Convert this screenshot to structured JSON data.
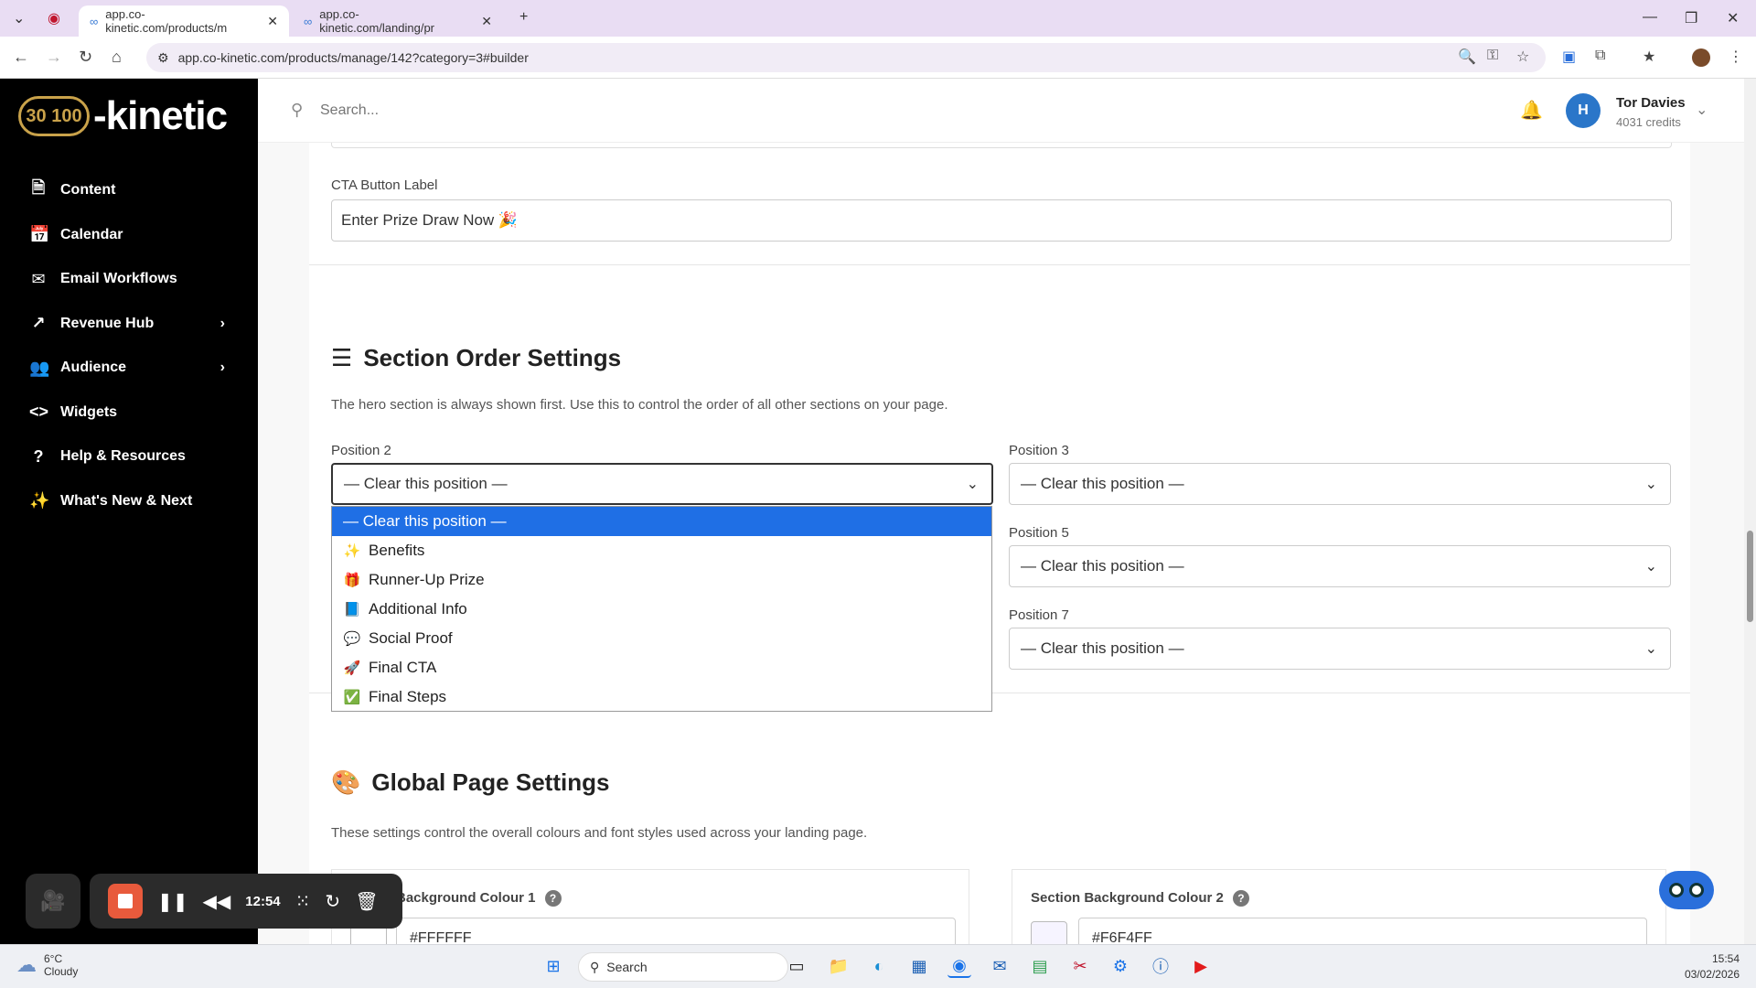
{
  "browser": {
    "tabs": [
      {
        "title": "app.co-kinetic.com/products/m",
        "active": true
      },
      {
        "title": "app.co-kinetic.com/landing/pr",
        "active": false
      }
    ],
    "new_tab": "+",
    "url": "app.co-kinetic.com/products/manage/142?category=3#builder"
  },
  "app": {
    "logo_badge": "30 100",
    "logo_text": "-kinetic",
    "nav": [
      {
        "label": "Content",
        "icon": "document-icon",
        "glyph": "🗎",
        "expandable": false
      },
      {
        "label": "Calendar",
        "icon": "calendar-icon",
        "glyph": "📅",
        "expandable": false
      },
      {
        "label": "Email Workflows",
        "icon": "mail-icon",
        "glyph": "✉",
        "expandable": false
      },
      {
        "label": "Revenue Hub",
        "icon": "trend-icon",
        "glyph": "↗",
        "expandable": true
      },
      {
        "label": "Audience",
        "icon": "users-icon",
        "glyph": "👥",
        "expandable": true
      },
      {
        "label": "Widgets",
        "icon": "code-icon",
        "glyph": "<>",
        "expandable": false
      },
      {
        "label": "Help & Resources",
        "icon": "help-icon",
        "glyph": "?",
        "expandable": false
      },
      {
        "label": "What's New & Next",
        "icon": "sparkle-icon",
        "glyph": "✨",
        "expandable": false
      }
    ]
  },
  "header": {
    "search_placeholder": "Search...",
    "avatar_initial": "H",
    "user_name": "Tor Davies",
    "credits": "4031 credits"
  },
  "cta": {
    "label": "CTA Button Label",
    "value": "Enter Prize Draw Now 🎉"
  },
  "section_order": {
    "title": "Section Order Settings",
    "description": "The hero section is always shown first. Use this to control the order of all other sections on your page.",
    "positions": [
      {
        "label": "Position 2",
        "value": "— Clear this position —"
      },
      {
        "label": "Position 3",
        "value": "— Clear this position —"
      },
      {
        "label": "Position 5",
        "value": "— Clear this position —"
      },
      {
        "label": "Position 7",
        "value": "— Clear this position —"
      }
    ],
    "dropdown_options": [
      {
        "emoji": "",
        "label": "— Clear this position —",
        "selected": true
      },
      {
        "emoji": "✨",
        "label": "Benefits",
        "selected": false
      },
      {
        "emoji": "🎁",
        "label": "Runner-Up Prize",
        "selected": false
      },
      {
        "emoji": "📘",
        "label": "Additional Info",
        "selected": false
      },
      {
        "emoji": "💬",
        "label": "Social Proof",
        "selected": false
      },
      {
        "emoji": "🚀",
        "label": "Final CTA",
        "selected": false
      },
      {
        "emoji": "✅",
        "label": "Final Steps",
        "selected": false
      }
    ]
  },
  "global_settings": {
    "emoji": "🎨",
    "title": "Global Page Settings",
    "description": "These settings control the overall colours and font styles used across your landing page.",
    "bg1_label": "Background Colour 1",
    "bg1_value": "#FFFFFF",
    "bg2_label": "Section Background Colour 2",
    "bg2_value": "#F6F4FF"
  },
  "recorder": {
    "time": "12:54"
  },
  "taskbar": {
    "temp": "6°C",
    "condition": "Cloudy",
    "search": "Search",
    "time": "15:54",
    "date": "03/02/2026"
  },
  "colors": {
    "accent": "#1f6fe5",
    "sidebar_bg": "#000000",
    "tabbar_bg": "#e9ddf3",
    "avatar": "#2a76c9",
    "rec_stop": "#e85a3c"
  }
}
